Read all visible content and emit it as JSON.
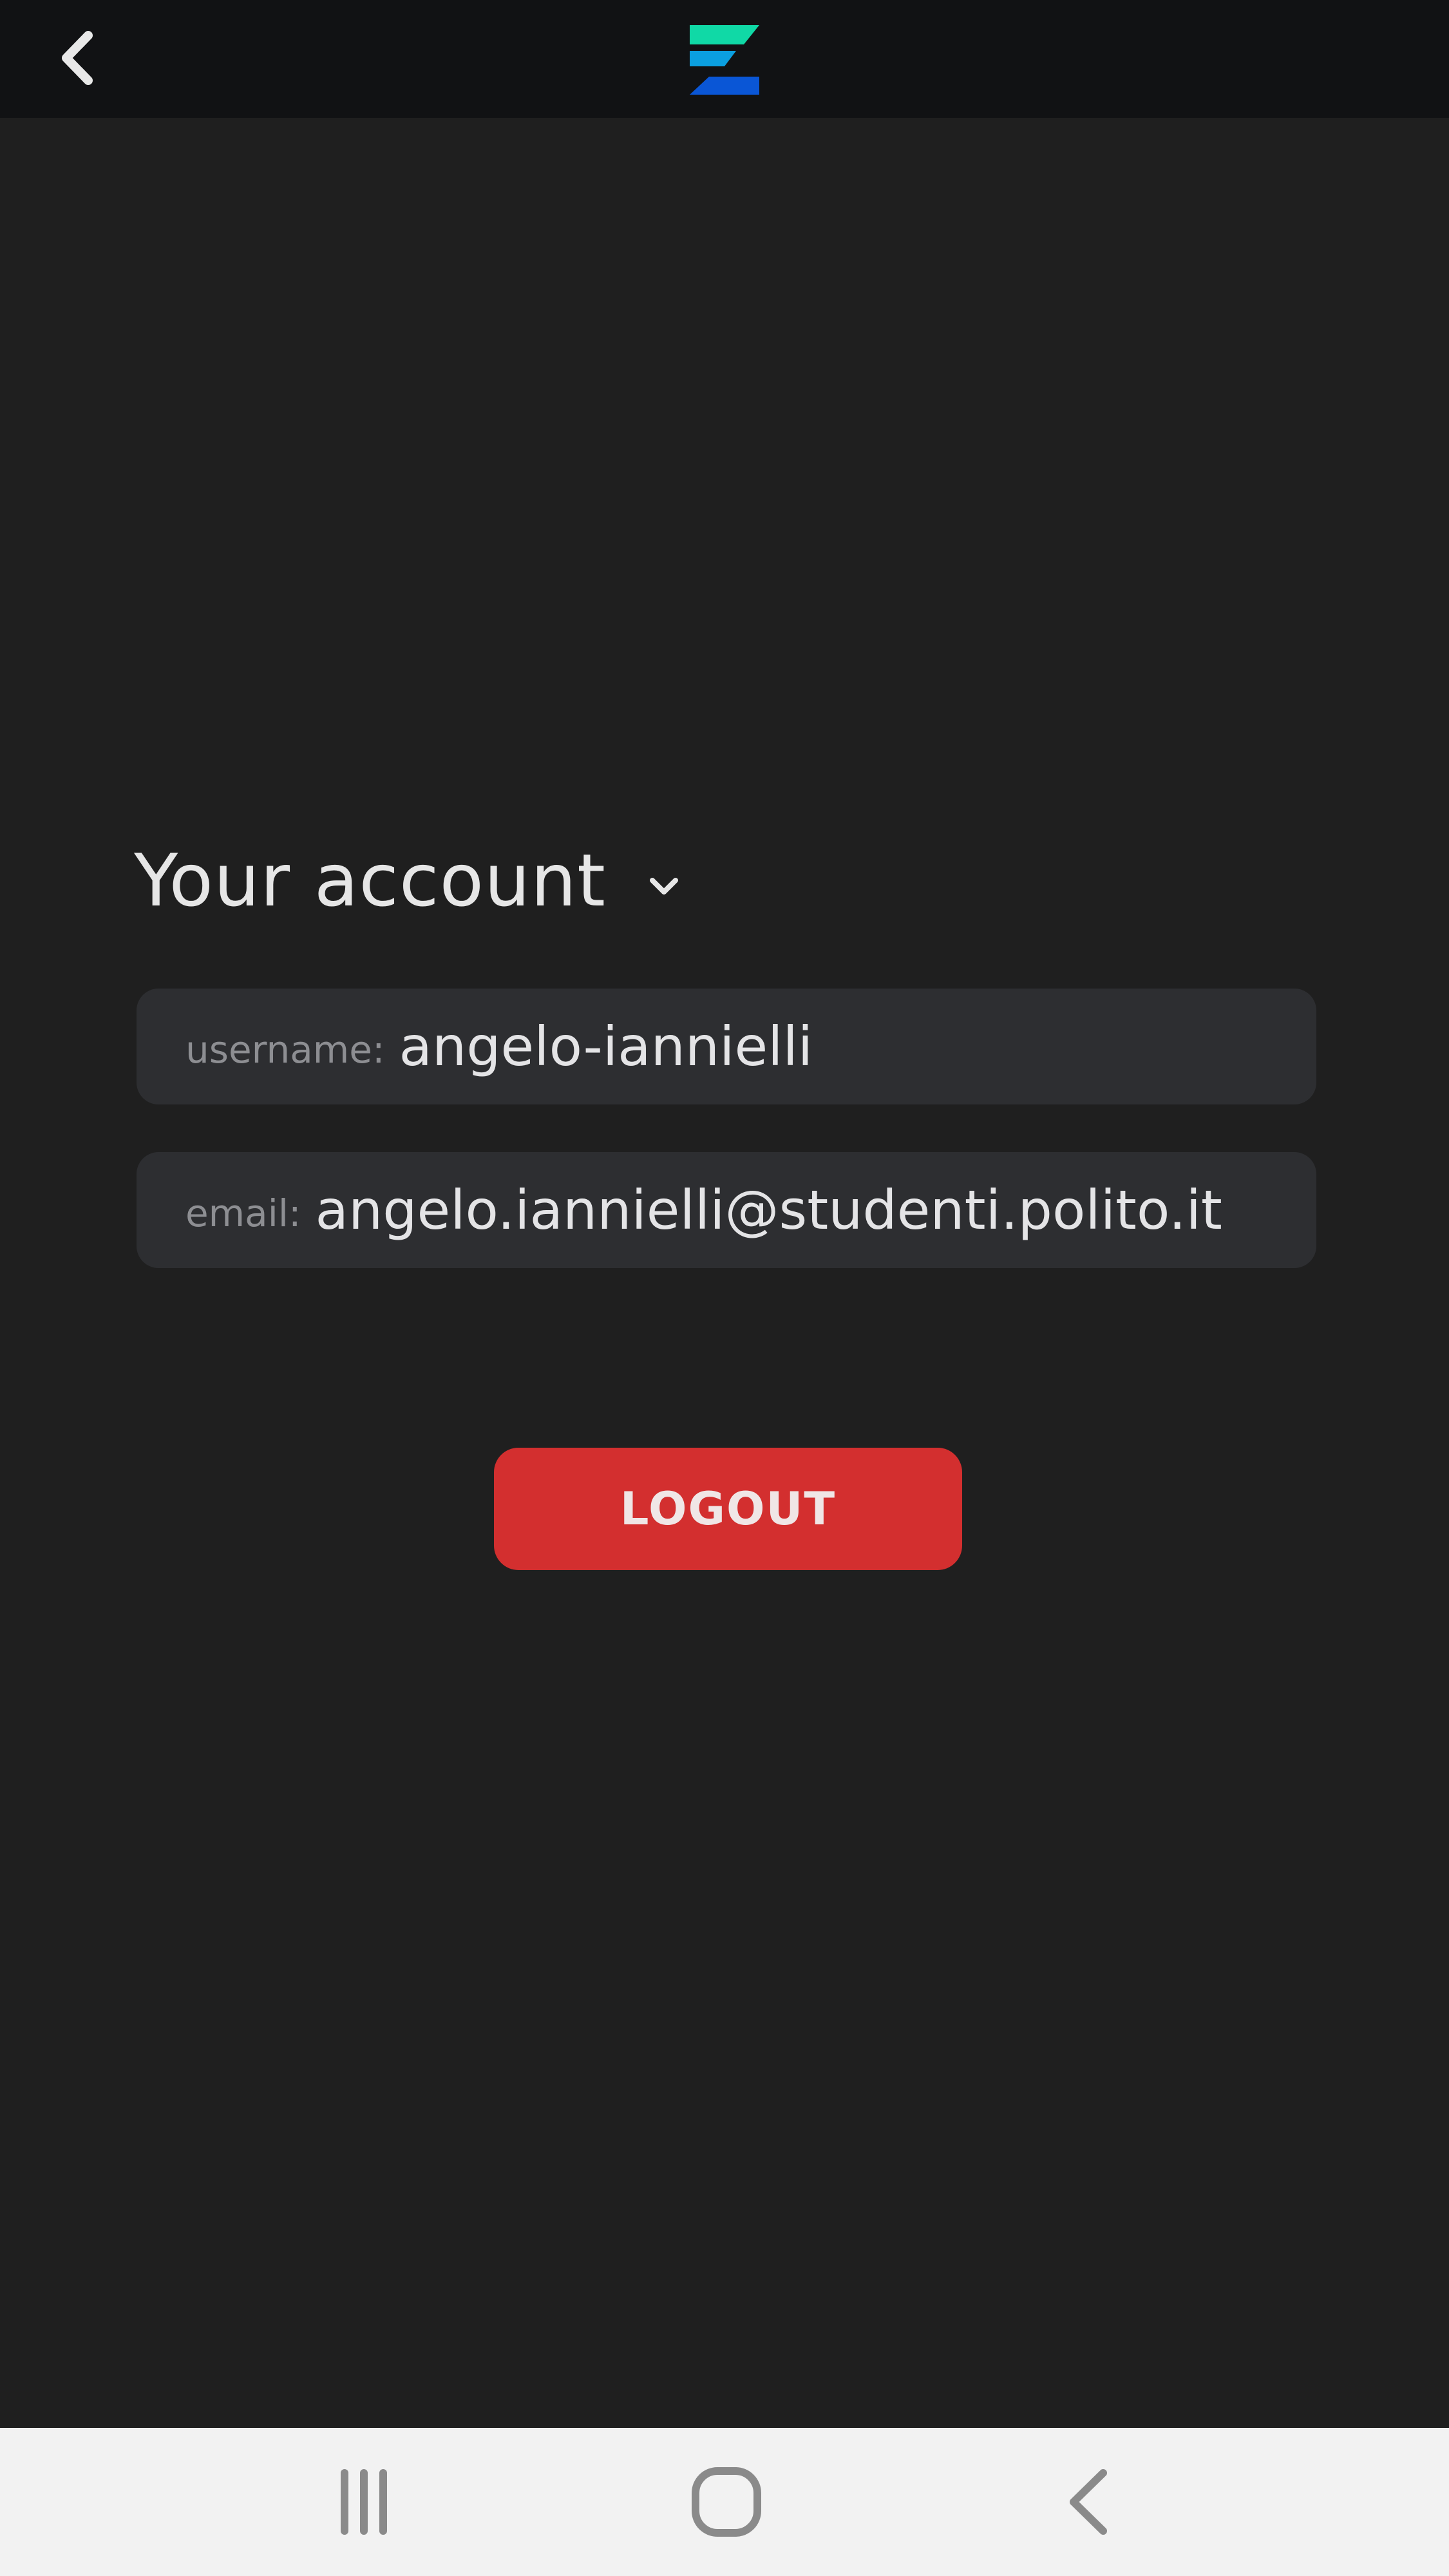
{
  "topbar": {
    "back_icon": "chevron-left-icon",
    "logo_icon": "app-logo",
    "logo_colors": [
      "#10d9a6",
      "#0b9fe0",
      "#0a56d6"
    ]
  },
  "account": {
    "title": "Your account",
    "toggle_icon": "chevron-down-icon",
    "username_label": "username:",
    "username_value": "angelo-iannielli",
    "email_label": "email:",
    "email_value": "angelo.iannielli@studenti.polito.it"
  },
  "actions": {
    "logout_label": "LOGOUT",
    "logout_color": "#d32f2f"
  },
  "system_nav": {
    "recents_icon": "recents-icon",
    "home_icon": "home-icon",
    "back_icon": "back-icon"
  }
}
